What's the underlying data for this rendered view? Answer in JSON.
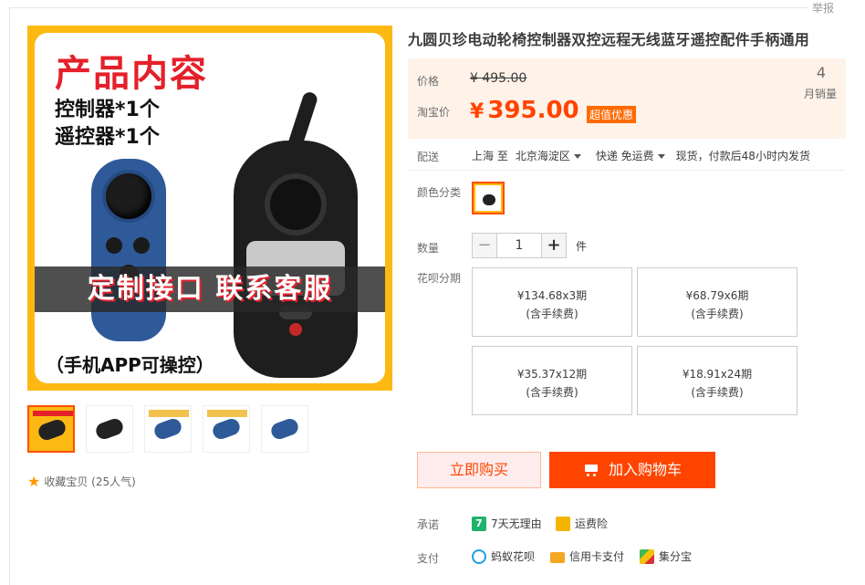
{
  "report": "举报",
  "gallery": {
    "main_image": {
      "heading": "产品内容",
      "line1": "控制器*1个",
      "line2": "遥控器*1个",
      "band": "定制接口 联系客服",
      "bottom": "（手机APP可操控）"
    },
    "thumbnail_count": 5
  },
  "favorite": {
    "label": "收藏宝贝 (25人气)"
  },
  "product": {
    "title": "九圆贝珍电动轮椅控制器双控远程无线蓝牙遥控配件手柄通用"
  },
  "price": {
    "label_price": "价格",
    "label_promo": "淘宝价",
    "original": "¥ 495.00",
    "currency": "¥",
    "promo": "395.00",
    "tag": "超值优惠",
    "monthly_sales": "4",
    "monthly_sales_label": "月销量"
  },
  "shipping": {
    "label": "配送",
    "from": "上海 至",
    "to": "北京海淀区",
    "method": "快递 免运费",
    "note": "现货，付款后48小时内发货"
  },
  "color": {
    "label": "颜色分类"
  },
  "quantity": {
    "label": "数量",
    "value": "1",
    "unit": "件",
    "minus": "−",
    "plus": "+"
  },
  "installments": {
    "label": "花呗分期",
    "plans": [
      {
        "amount": "¥134.68x3期",
        "fee": "(含手续费)"
      },
      {
        "amount": "¥68.79x6期",
        "fee": "(含手续费)"
      },
      {
        "amount": "¥35.37x12期",
        "fee": "(含手续费)"
      },
      {
        "amount": "¥18.91x24期",
        "fee": "(含手续费)"
      }
    ]
  },
  "actions": {
    "buy_now": "立即购买",
    "add_to_cart": "加入购物车"
  },
  "promise": {
    "label": "承诺",
    "items": [
      "7天无理由",
      "运费险"
    ],
    "seven_glyph": "7"
  },
  "payment": {
    "label": "支付",
    "items": [
      "蚂蚁花呗",
      "信用卡支付",
      "集分宝"
    ]
  },
  "colors": {
    "accent": "#ff4400",
    "price_bg": "#fff2e8",
    "frame": "#fdb913"
  }
}
